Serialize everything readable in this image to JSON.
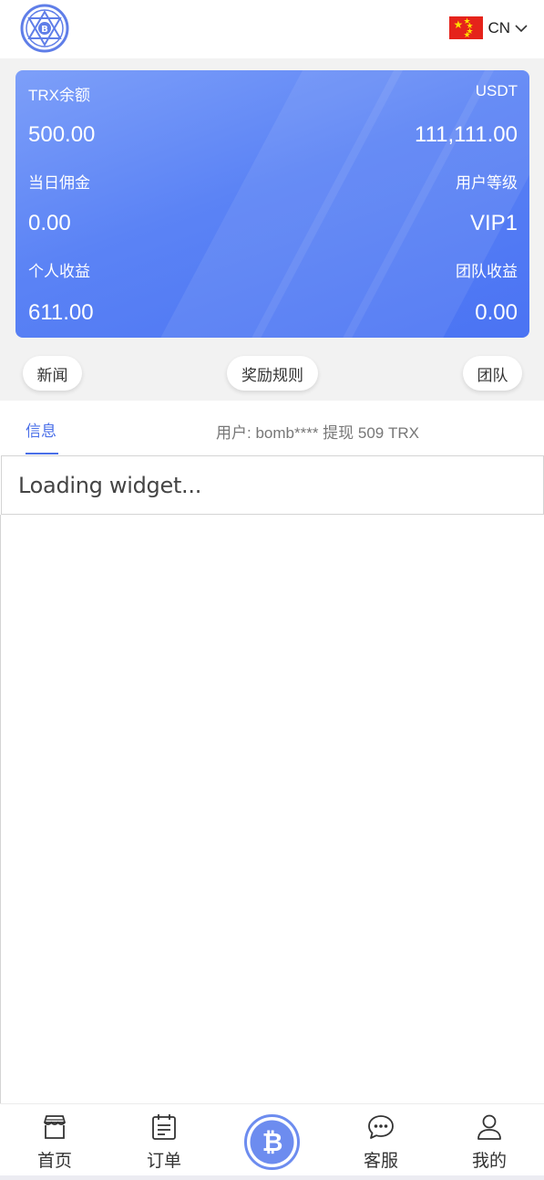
{
  "header": {
    "language": "CN"
  },
  "balances": {
    "trx_label": "TRX余额",
    "trx_value": "500.00",
    "usdt_label": "USDT",
    "usdt_value": "111,111.00",
    "daily_commission_label": "当日佣金",
    "daily_commission_value": "0.00",
    "user_level_label": "用户等级",
    "user_level_value": "VIP1",
    "personal_income_label": "个人收益",
    "personal_income_value": "611.00",
    "team_income_label": "团队收益",
    "team_income_value": "0.00"
  },
  "quick_links": {
    "news": "新闻",
    "rewards": "奖励规则",
    "team": "团队"
  },
  "info": {
    "tab_label": "信息",
    "ticker": "用户: bomb**** 提现 509 TRX"
  },
  "widget": {
    "loading": "Loading widget..."
  },
  "tabbar": {
    "home": "首页",
    "orders": "订单",
    "support": "客服",
    "mine": "我的"
  },
  "colors": {
    "accent": "#4a6fe8",
    "card_top": "#7d9ff9",
    "card_bottom": "#4a73f3",
    "flag_red": "#e5231b"
  },
  "icons": [
    "logo-emblem-icon",
    "china-flag-icon",
    "chevron-down-icon",
    "store-icon",
    "clipboard-icon",
    "bitcoin-icon",
    "chat-bubble-icon",
    "user-icon"
  ]
}
